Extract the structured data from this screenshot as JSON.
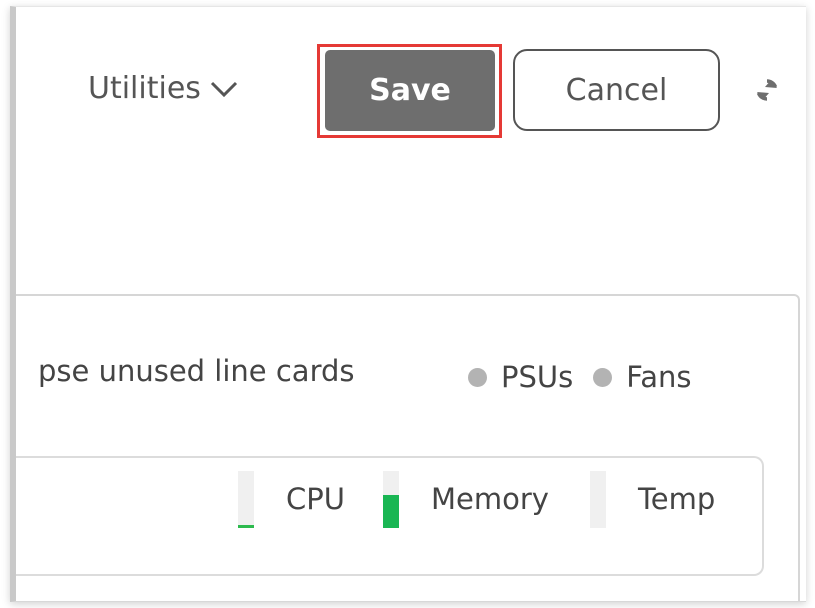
{
  "toolbar": {
    "utilities_label": "Utilities",
    "save_label": "Save",
    "cancel_label": "Cancel"
  },
  "icons": {
    "utilities_dropdown": "chevron-down-icon",
    "refresh": "refresh-icon"
  },
  "panel": {
    "collapse_label": "pse unused line cards",
    "status_legend": [
      {
        "label": "PSUs",
        "color": "#b3b3b3"
      },
      {
        "label": "Fans",
        "color": "#b3b3b3"
      }
    ],
    "metrics": [
      {
        "label": "CPU",
        "level": 0.03,
        "color": "#2dba4e"
      },
      {
        "label": "Memory",
        "level": 0.58,
        "color": "#19b653"
      },
      {
        "label": "Temp",
        "level": 0.0,
        "color": "#2dba4e"
      }
    ]
  },
  "colors": {
    "save_button": "#6e6e6e",
    "highlight": "#e53935",
    "accent_green": "#19b653"
  }
}
